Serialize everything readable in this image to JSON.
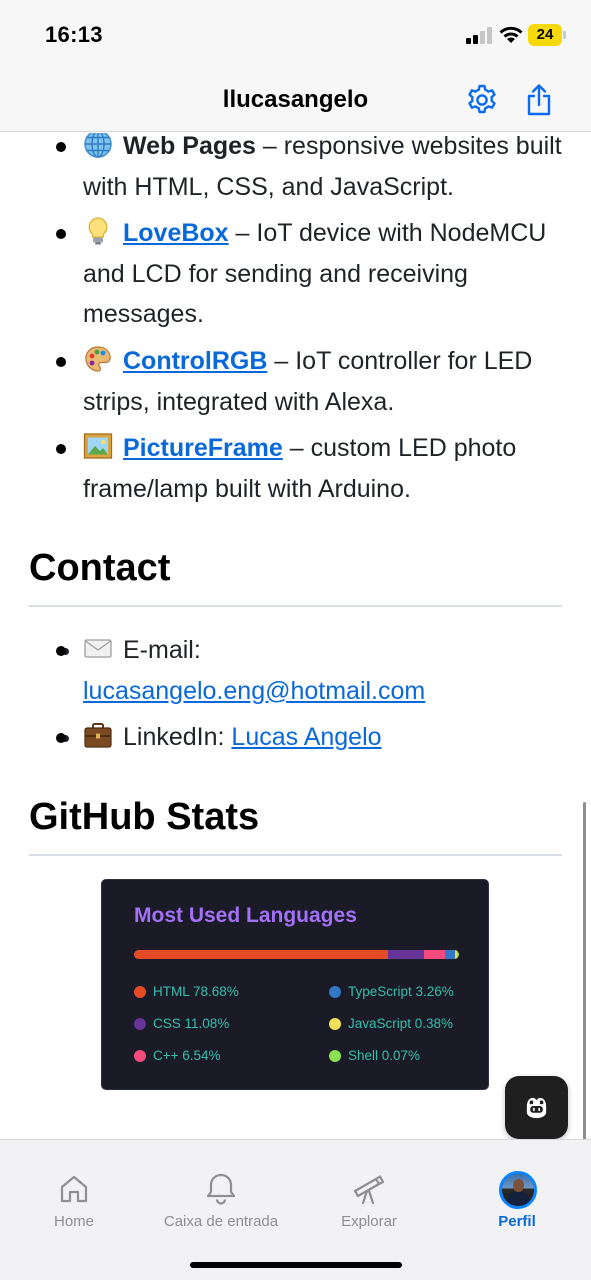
{
  "status_bar": {
    "time": "16:13",
    "battery": "24"
  },
  "nav": {
    "title": "llucasangelo",
    "settings_icon": "gear-icon",
    "share_icon": "share-icon"
  },
  "projects": [
    {
      "emoji": "globe-emoji",
      "name": "Web Pages",
      "linked": false,
      "desc": " – responsive websites built with HTML, CSS, and JavaScript."
    },
    {
      "emoji": "light-bulb-emoji",
      "name": "LoveBox",
      "linked": true,
      "desc": " – IoT device with NodeMCU and LCD for sending and receiving messages."
    },
    {
      "emoji": "palette-emoji",
      "name": "ControlRGB",
      "linked": true,
      "desc": " – IoT controller for LED strips, integrated with Alexa."
    },
    {
      "emoji": "framed-picture-emoji",
      "name": "PictureFrame",
      "linked": true,
      "desc": " – custom LED photo frame/lamp built with Arduino."
    }
  ],
  "contact": {
    "heading": "Contact",
    "email_label": "E-mail:",
    "email_value": "lucasangelo.eng@hotmail.com",
    "linkedin_label": "LinkedIn:",
    "linkedin_value": "Lucas Angelo"
  },
  "stats": {
    "heading": "GitHub Stats",
    "card_title": "Most Used Languages",
    "languages": [
      {
        "name": "HTML",
        "pct": 78.68,
        "label": "HTML 78.68%",
        "color": "#e34c26"
      },
      {
        "name": "CSS",
        "pct": 11.08,
        "label": "CSS 11.08%",
        "color": "#663399"
      },
      {
        "name": "C++",
        "pct": 6.54,
        "label": "C++ 6.54%",
        "color": "#f34b7d"
      },
      {
        "name": "TypeScript",
        "pct": 3.26,
        "label": "TypeScript 3.26%",
        "color": "#3178c6"
      },
      {
        "name": "JavaScript",
        "pct": 0.38,
        "label": "JavaScript 0.38%",
        "color": "#f1e05a"
      },
      {
        "name": "Shell",
        "pct": 0.07,
        "label": "Shell 0.07%",
        "color": "#89e051"
      }
    ]
  },
  "tabs": [
    {
      "label": "Home",
      "icon": "home-icon",
      "active": false
    },
    {
      "label": "Caixa de entrada",
      "icon": "bell-icon",
      "active": false
    },
    {
      "label": "Explorar",
      "icon": "telescope-icon",
      "active": false
    },
    {
      "label": "Perfil",
      "icon": "avatar",
      "active": true
    }
  ],
  "colors": {
    "link": "#0969da",
    "card_bg": "#1a1b27",
    "card_title": "#a371f7",
    "legend_text": "#38bdae"
  }
}
